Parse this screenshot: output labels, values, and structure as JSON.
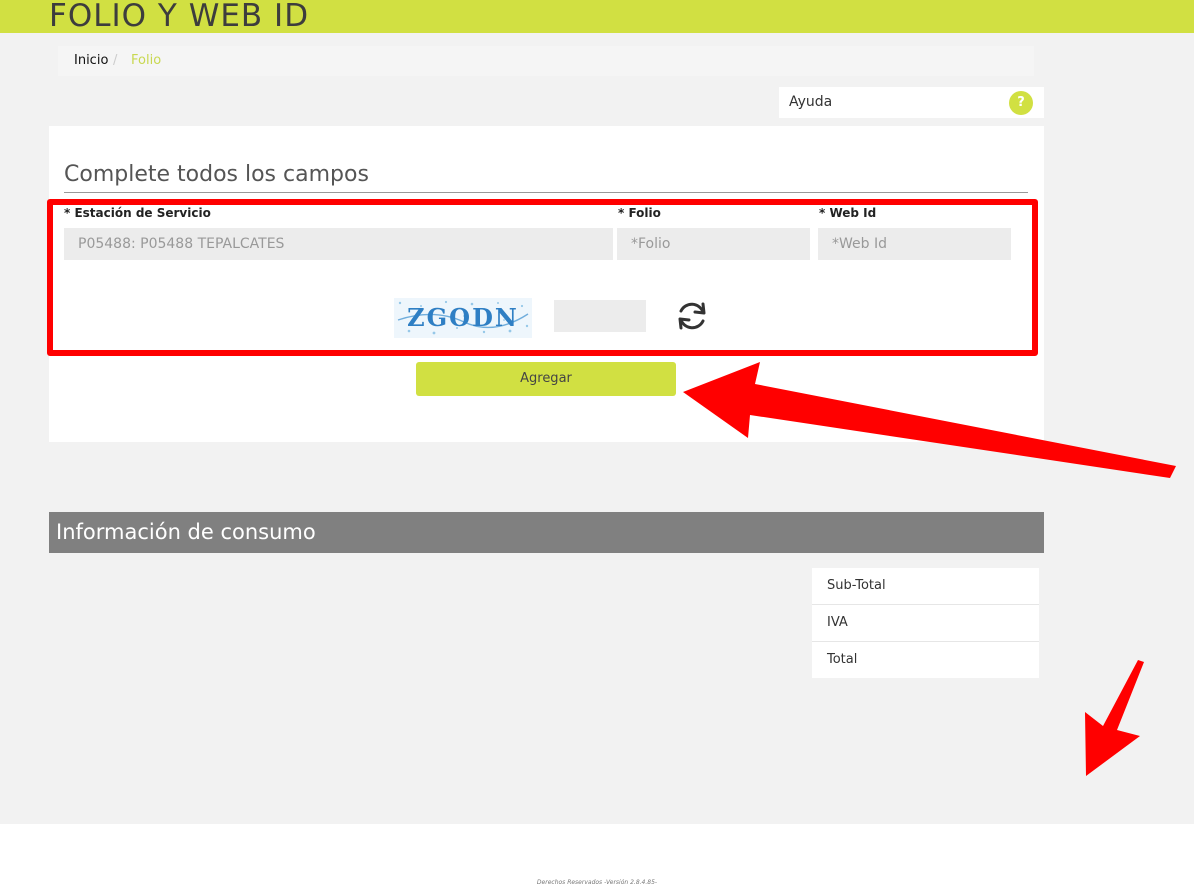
{
  "header": {
    "title": "FOLIO Y WEB ID",
    "accent_color": "#d1e042"
  },
  "breadcrumb": {
    "home": "Inicio",
    "separator": "/",
    "current": "Folio"
  },
  "help": {
    "label": "Ayuda",
    "icon": "?"
  },
  "form": {
    "heading": "Complete todos los campos",
    "station_label": "* Estación de Servicio",
    "station_value": "P05488: P05488 TEPALCATES",
    "folio_label": "* Folio",
    "folio_placeholder": "*Folio",
    "webid_label": "* Web Id",
    "webid_placeholder": "*Web Id",
    "captcha_text": "ZGODN",
    "submit_label": "Agregar"
  },
  "consumo": {
    "title": "Información de consumo",
    "rows": [
      "Sub-Total",
      "IVA",
      "Total"
    ]
  },
  "footer": {
    "text": "Derechos Reservados -Versión 2.8.4.85-"
  },
  "annotation_color": "#ff0000"
}
